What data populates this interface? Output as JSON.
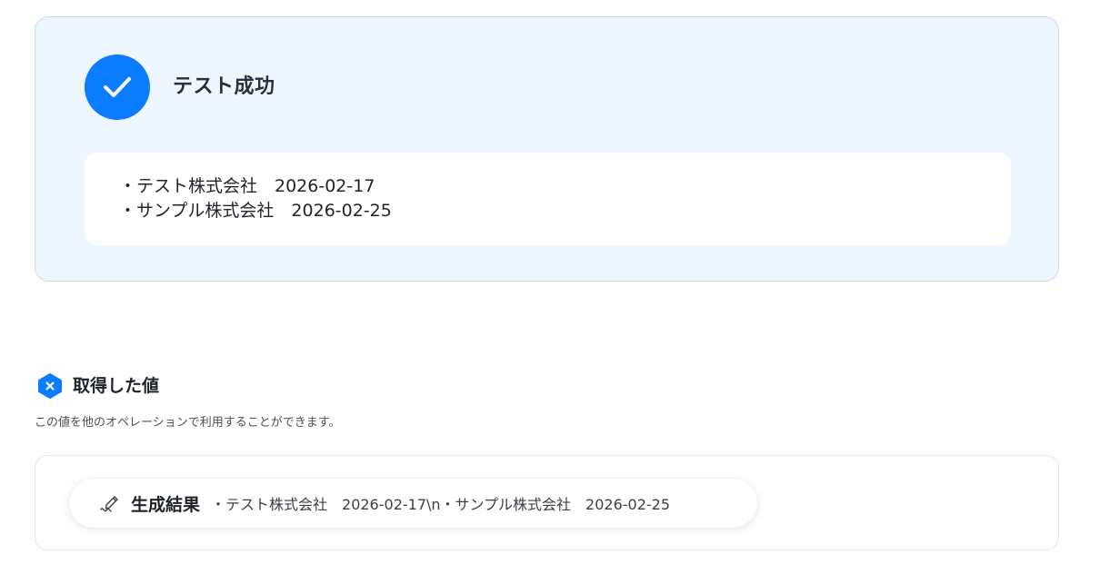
{
  "success": {
    "icon": "check-icon",
    "title": "テスト成功",
    "lines": [
      "・テスト株式会社　2026-02-17",
      "・サンプル株式会社　2026-02-25"
    ]
  },
  "values_section": {
    "icon": "variable-hexagon-icon",
    "title": "取得した値",
    "description": "この値を他のオペレーションで利用することができます。",
    "chips": [
      {
        "icon": "pen-signature-icon",
        "label": "生成結果",
        "value": "・テスト株式会社　2026-02-17\\n・サンプル株式会社　2026-02-25"
      }
    ]
  },
  "colors": {
    "accent": "#0a7cff",
    "success_card_bg": "#eef6ff",
    "border": "#cfdae6"
  }
}
